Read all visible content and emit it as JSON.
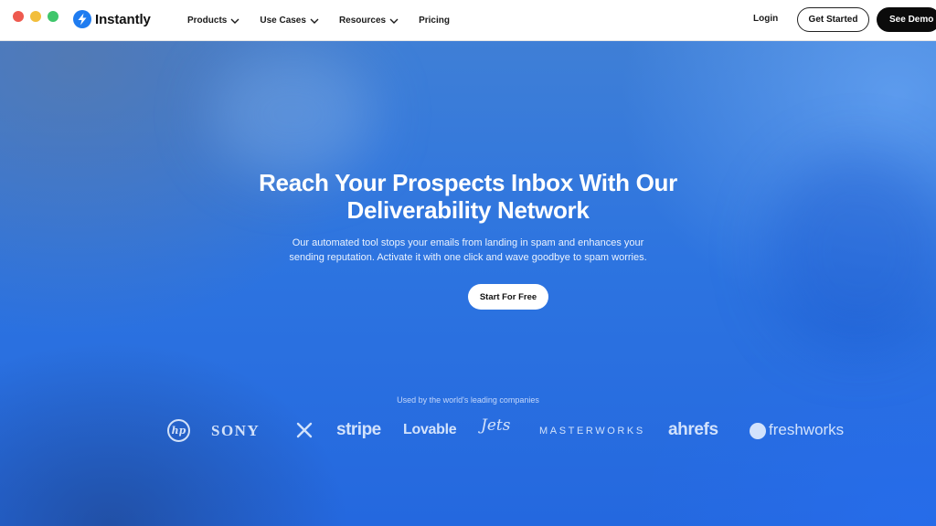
{
  "window": {
    "controls": [
      "close",
      "minimize",
      "maximize"
    ]
  },
  "brand": {
    "name": "Instantly",
    "icon": "lightning-bolt-icon",
    "accent": "#1f7cf0"
  },
  "nav": {
    "items": [
      {
        "label": "Products",
        "has_dropdown": true
      },
      {
        "label": "Use Cases",
        "has_dropdown": true
      },
      {
        "label": "Resources",
        "has_dropdown": true
      },
      {
        "label": "Pricing",
        "has_dropdown": false
      }
    ],
    "login": "Login",
    "get_started": "Get Started",
    "see_demo": "See Demo"
  },
  "hero": {
    "title_line1": "Reach Your Prospects Inbox With Our",
    "title_line2": "Deliverability Network",
    "subtitle_line1": "Our automated tool stops your emails from landing in spam and enhances your",
    "subtitle_line2": "sending reputation. Activate it with one click and wave goodbye to spam worries.",
    "cta": "Start For Free",
    "background_color": "#2a6fd8"
  },
  "social_proof": {
    "caption": "Used by the world's leading companies",
    "logos": [
      {
        "name": "hp",
        "text": "hp"
      },
      {
        "name": "sony",
        "text": "SONY"
      },
      {
        "name": "x",
        "text": ""
      },
      {
        "name": "stripe",
        "text": "stripe"
      },
      {
        "name": "lovable",
        "text": "Lovable"
      },
      {
        "name": "jets",
        "text": "Jets"
      },
      {
        "name": "masterworks",
        "text": "MASTERWORKS"
      },
      {
        "name": "ahrefs",
        "text": "ahrefs"
      },
      {
        "name": "freshworks",
        "text": "freshworks"
      }
    ]
  }
}
